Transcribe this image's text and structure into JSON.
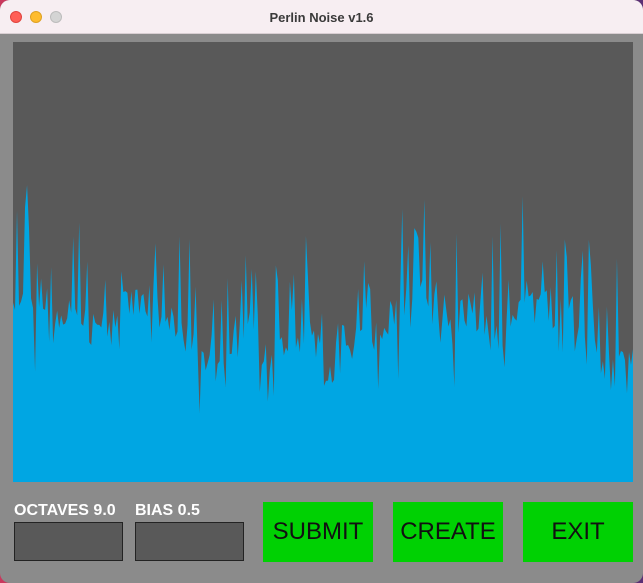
{
  "window": {
    "title": "Perlin Noise v1.6",
    "controls": [
      "close",
      "minimize",
      "zoom"
    ]
  },
  "noise_view": {
    "background_color": "#595959",
    "fill_color": "#00a6e3",
    "max_value": 1
  },
  "settings": {
    "octaves_label": "OCTAVES 9.0",
    "bias_label": "BIAS 0.5",
    "octaves_value": "",
    "bias_value": ""
  },
  "buttons": {
    "submit": "SUBMIT",
    "create": "CREATE",
    "exit": "EXIT"
  },
  "colors": {
    "window_background": "#8b8b8b",
    "button_green": "#00d103",
    "input_background": "#595959"
  }
}
